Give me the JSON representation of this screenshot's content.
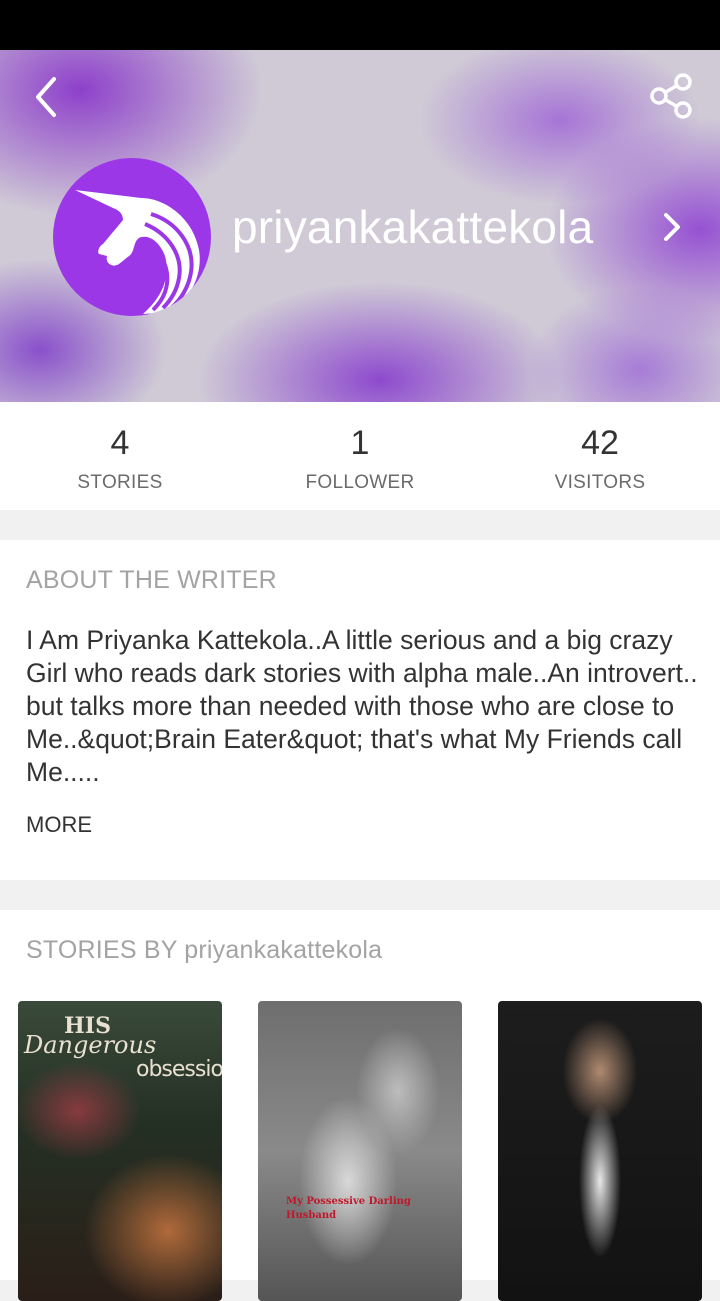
{
  "profile": {
    "username": "priyankakattekola"
  },
  "stats": [
    {
      "value": "4",
      "label": "STORIES"
    },
    {
      "value": "1",
      "label": "FOLLOWER"
    },
    {
      "value": "42",
      "label": "VISITORS"
    }
  ],
  "about": {
    "title": "ABOUT THE WRITER",
    "text": "I Am Priyanka Kattekola..A little serious and a big crazy Girl who reads dark stories with alpha male..An introvert.. but talks more than needed with those who are close to Me..&quot;Brain Eater&quot; that's what My Friends call Me.....",
    "more_label": "MORE"
  },
  "stories": {
    "title": "STORIES BY priyankakattekola",
    "covers": [
      {
        "title_line1": "HIS",
        "title_line2": "Dangerous",
        "title_line3": "obsession"
      },
      {
        "title": "My Possessive Darling Husband"
      },
      {}
    ]
  },
  "icons": {
    "back": "back-arrow-icon",
    "share": "share-icon",
    "avatar": "unicorn-icon",
    "chevron": "chevron-right-icon"
  },
  "colors": {
    "accent": "#9c37e8",
    "header_bg": "#cfcad6"
  }
}
